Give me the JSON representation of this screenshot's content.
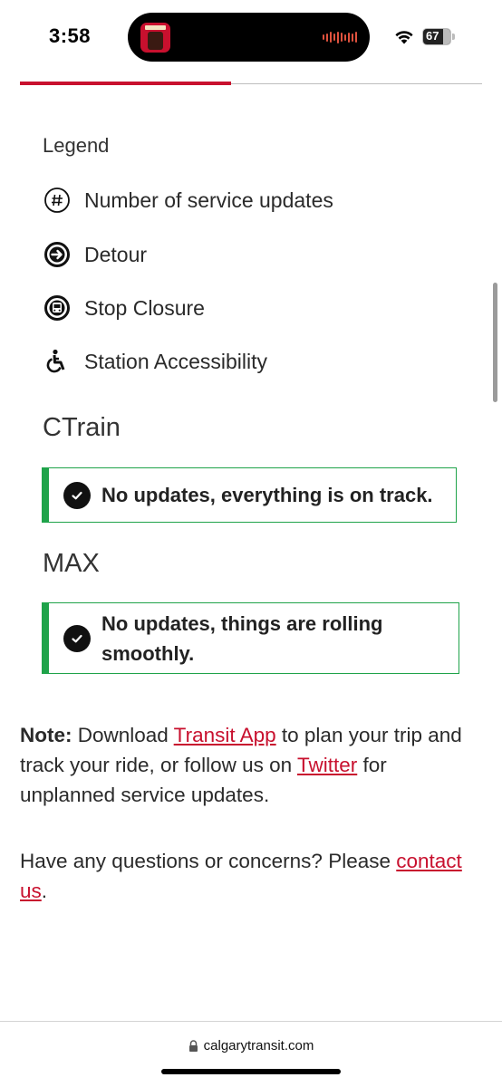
{
  "status_bar": {
    "time": "3:58",
    "battery_level": "67"
  },
  "legend": {
    "title": "Legend",
    "items": [
      {
        "icon": "hash-icon",
        "label": "Number of service updates"
      },
      {
        "icon": "detour-icon",
        "label": "Detour"
      },
      {
        "icon": "bus-stop-icon",
        "label": "Stop Closure"
      },
      {
        "icon": "wheelchair-icon",
        "label": "Station Accessibility"
      }
    ]
  },
  "ctrain": {
    "title": "CTrain",
    "status_message": "No updates, everything is on track."
  },
  "max": {
    "title": "MAX",
    "status_message": "No updates, things are rolling smoothly."
  },
  "note": {
    "label": "Note:",
    "text_1": " Download ",
    "transit_app_link": "Transit App",
    "text_2": " to plan your trip and track your ride, or follow us on ",
    "twitter_link": "Twitter",
    "text_3": " for unplanned service updates."
  },
  "questions": {
    "text": "Have any questions or concerns? Please ",
    "contact_link": "contact us",
    "period": "."
  },
  "browser": {
    "url": "calgarytransit.com"
  },
  "colors": {
    "brand_red": "#c8102e",
    "status_green": "#1fa34a"
  }
}
